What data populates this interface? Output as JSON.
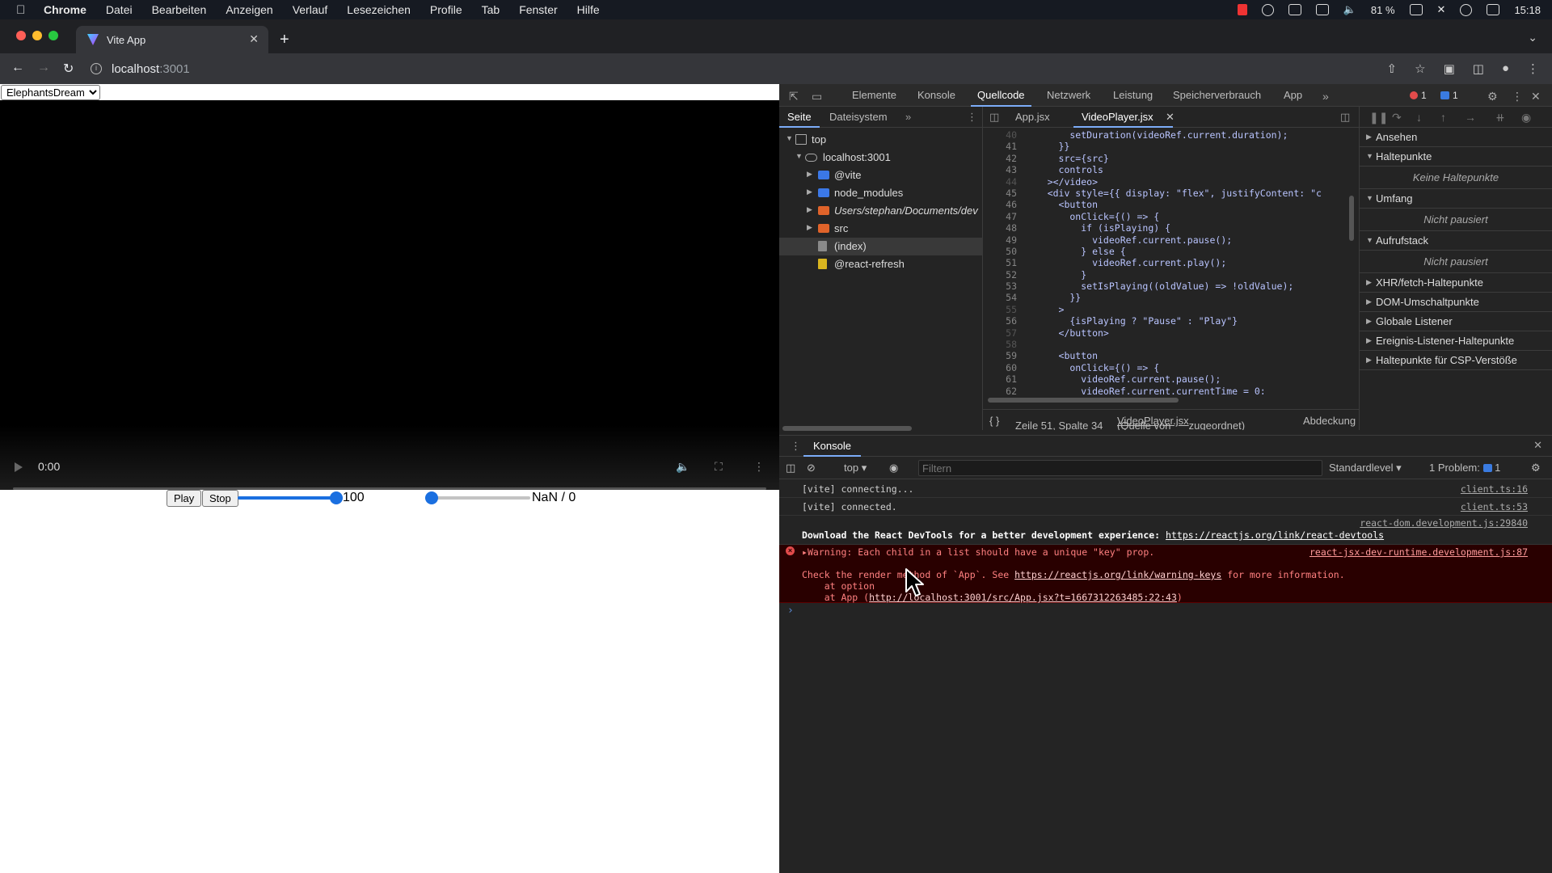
{
  "menubar": {
    "items": [
      "Chrome",
      "Datei",
      "Bearbeiten",
      "Anzeigen",
      "Verlauf",
      "Lesezeichen",
      "Profile",
      "Tab",
      "Fenster",
      "Hilfe"
    ],
    "battery": "81 %",
    "clock": "15:18"
  },
  "browser": {
    "tab_title": "Vite App",
    "url_host": "localhost",
    "url_port": ":3001"
  },
  "page": {
    "select_value": "ElephantsDream",
    "video_time": "0:00",
    "play_label": "Play",
    "stop_label": "Stop",
    "volume_value": 100,
    "volume_label": "100",
    "progress_fraction": 0,
    "progress_label": "NaN / 0"
  },
  "devtools": {
    "tabs": [
      "Elemente",
      "Konsole",
      "Quellcode",
      "Netzwerk",
      "Leistung",
      "Speicherverbrauch",
      "App"
    ],
    "active_tab": "Quellcode",
    "error_count": "1",
    "issue_count": "1",
    "sources": {
      "subtabs": [
        "Seite",
        "Dateisystem"
      ],
      "tree": [
        {
          "label": "top",
          "level": 0,
          "kind": "frame",
          "open": true
        },
        {
          "label": "localhost:3001",
          "level": 1,
          "kind": "cloud",
          "open": true
        },
        {
          "label": "@vite",
          "level": 2,
          "kind": "folder-blue",
          "open": false
        },
        {
          "label": "node_modules",
          "level": 2,
          "kind": "folder-blue",
          "open": false
        },
        {
          "label": "Users/stephan/Documents/dev",
          "level": 2,
          "kind": "folder-orange",
          "open": false
        },
        {
          "label": "src",
          "level": 2,
          "kind": "folder-orange",
          "open": false
        },
        {
          "label": "(index)",
          "level": 2,
          "kind": "file-grey",
          "selected": true
        },
        {
          "label": "@react-refresh",
          "level": 2,
          "kind": "file-yellow"
        }
      ],
      "editor_tabs": [
        "App.jsx",
        "VideoPlayer.jsx"
      ],
      "active_editor_tab": "VideoPlayer.jsx",
      "code_lines": [
        {
          "n": "40",
          "t": "        setDuration(videoRef.current.duration);",
          "dim": true
        },
        {
          "n": "41",
          "t": "      }}"
        },
        {
          "n": "42",
          "t": "      src={src}"
        },
        {
          "n": "43",
          "t": "      controls"
        },
        {
          "n": "44",
          "t": "    ></video>",
          "dim": true
        },
        {
          "n": "45",
          "t": "    <div style={{ display: \"flex\", justifyContent: \"c"
        },
        {
          "n": "46",
          "t": "      <button"
        },
        {
          "n": "47",
          "t": "        onClick={() => {"
        },
        {
          "n": "48",
          "t": "          if (isPlaying) {"
        },
        {
          "n": "49",
          "t": "            videoRef.current.pause();"
        },
        {
          "n": "50",
          "t": "          } else {"
        },
        {
          "n": "51",
          "t": "            videoRef.current.play();"
        },
        {
          "n": "52",
          "t": "          }"
        },
        {
          "n": "53",
          "t": "          setIsPlaying((oldValue) => !oldValue);"
        },
        {
          "n": "54",
          "t": "        }}"
        },
        {
          "n": "55",
          "t": "      >",
          "dim": true
        },
        {
          "n": "56",
          "t": "        {isPlaying ? \"Pause\" : \"Play\"}"
        },
        {
          "n": "57",
          "t": "      </button>",
          "dim": true
        },
        {
          "n": "58",
          "t": "",
          "dim": true
        },
        {
          "n": "59",
          "t": "      <button"
        },
        {
          "n": "60",
          "t": "        onClick={() => {"
        },
        {
          "n": "61",
          "t": "          videoRef.current.pause();"
        },
        {
          "n": "62",
          "t": "          videoRef.current.currentTime = 0;"
        }
      ],
      "status_position": "Zeile 51, Spalte 34",
      "status_source_pre": "(Quelle von ",
      "status_source_file": "VideoPlayer.jsx",
      "status_source_post": " zugeordnet)",
      "status_coverage": "Abdeckung"
    },
    "debugger": {
      "panes": [
        {
          "title": "Ansehen",
          "open": false
        },
        {
          "title": "Haltepunkte",
          "open": true,
          "empty": "Keine Haltepunkte"
        },
        {
          "title": "Umfang",
          "open": true,
          "empty": "Nicht pausiert"
        },
        {
          "title": "Aufrufstack",
          "open": true,
          "empty": "Nicht pausiert"
        },
        {
          "title": "XHR/fetch-Haltepunkte",
          "open": false
        },
        {
          "title": "DOM-Umschaltpunkte",
          "open": false
        },
        {
          "title": "Globale Listener",
          "open": false
        },
        {
          "title": "Ereignis-Listener-Haltepunkte",
          "open": false
        },
        {
          "title": "Haltepunkte für CSP-Verstöße",
          "open": false
        }
      ]
    },
    "console": {
      "drawer_tab": "Konsole",
      "context": "top",
      "filter_placeholder": "Filtern",
      "level": "Standardlevel",
      "problems_label": "1 Problem:",
      "problems_count": "1",
      "logs": {
        "l1_msg": "[vite] connecting...",
        "l1_src": "client.ts:16",
        "l2_msg": "[vite] connected.",
        "l2_src": "client.ts:53",
        "l3_src": "react-dom.development.js:29840",
        "l3_msg": "Download the React DevTools for a better development experience: ",
        "l3_link": "https://reactjs.org/link/react-devtools",
        "l4_msg": "Warning: Each child in a list should have a unique \"key\" prop.",
        "l4_src": "react-jsx-dev-runtime.development.js:87",
        "l4_line2_pre": "Check the render method of `App`. See ",
        "l4_line2_link": "https://reactjs.org/link/warning-keys",
        "l4_line2_post": " for more information.",
        "l4_line3": "    at option",
        "l4_line4_pre": "    at App (",
        "l4_line4_link": "http://localhost:3001/src/App.jsx?t=1667312263485:22:43",
        "l4_line4_post": ")"
      }
    }
  }
}
